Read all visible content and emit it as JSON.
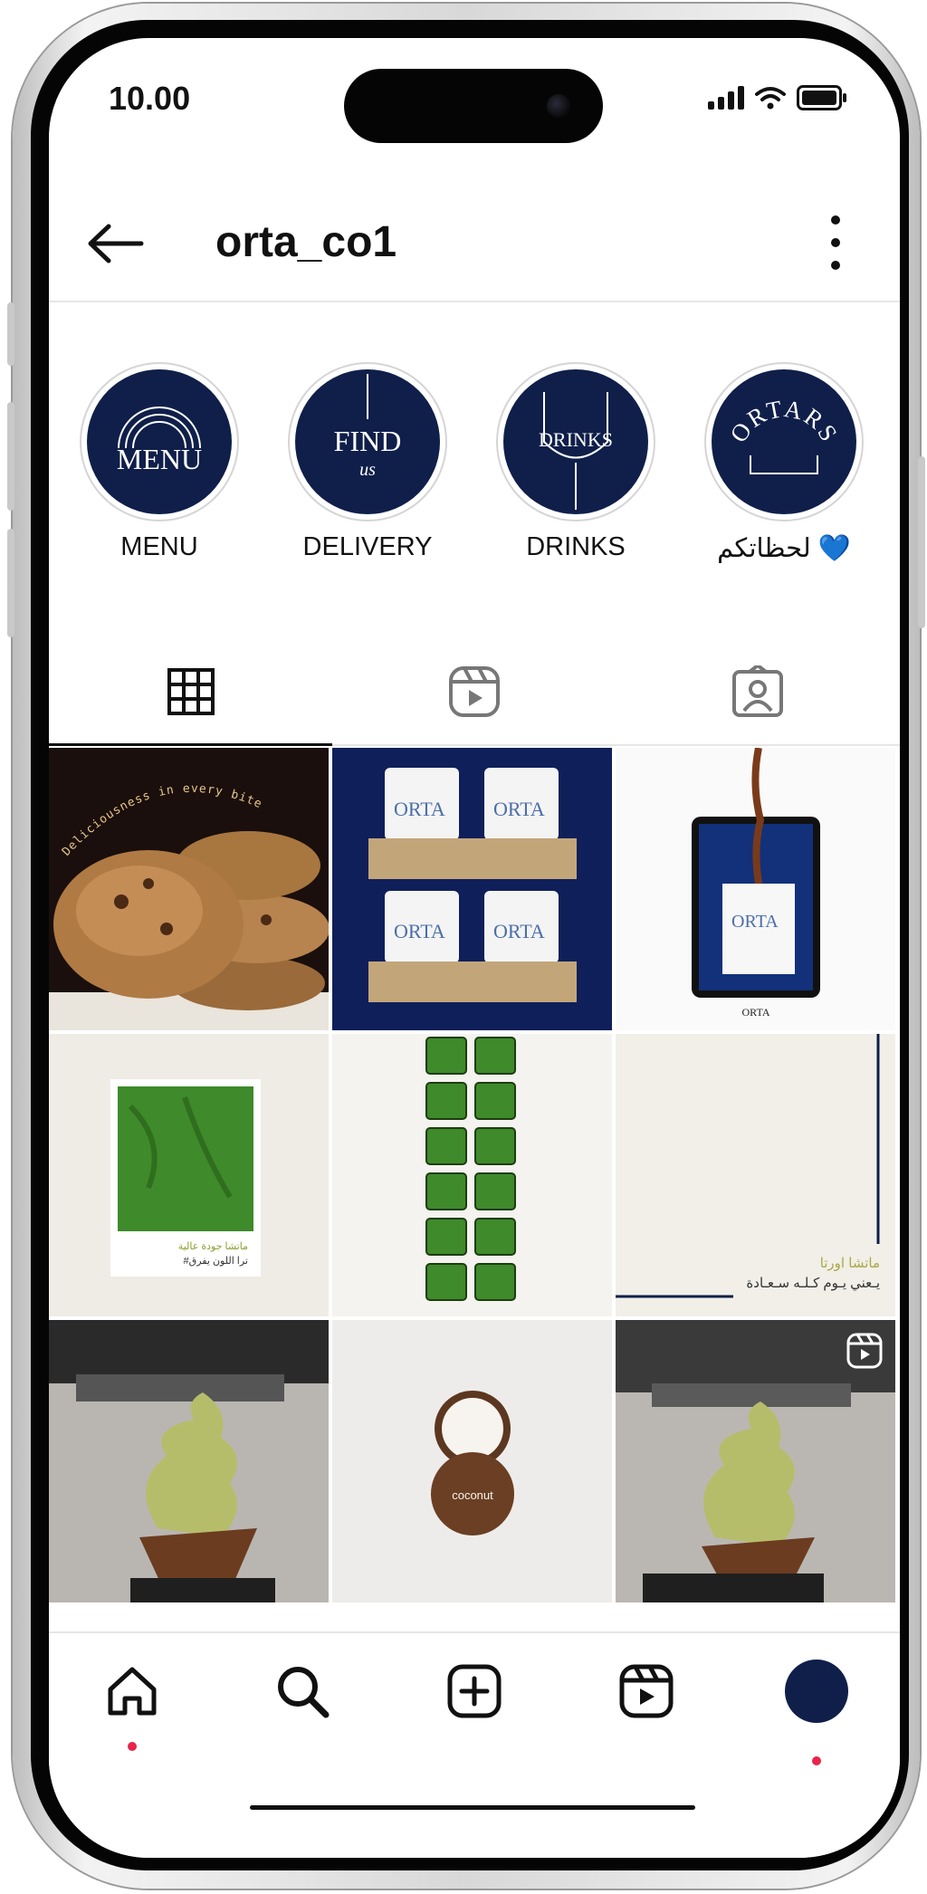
{
  "status_bar": {
    "time": "10.00"
  },
  "header": {
    "username": "orta_co1"
  },
  "highlights": [
    {
      "label": "MENU",
      "cover_text": "MENU"
    },
    {
      "label": "DELIVERY",
      "cover_text": "FIND",
      "cover_subtext": "us"
    },
    {
      "label": "DRINKS",
      "cover_text": "DRINKS"
    },
    {
      "label": "لحظاتكم 💙",
      "cover_text": "ORTARS"
    }
  ],
  "tabs": [
    {
      "name": "grid",
      "icon": "grid-icon",
      "active": true
    },
    {
      "name": "reels",
      "icon": "reels-icon",
      "active": false
    },
    {
      "name": "tagged",
      "icon": "tagged-icon",
      "active": false
    }
  ],
  "posts": {
    "cookies_caption": "Deliciousness in every bite",
    "cup_brand": "ORTA",
    "matcha_caption_1": "ماتشا جودة عالية",
    "matcha_caption_2": "#ترا اللون يفرق",
    "quote_title": "ماتشا اورتا",
    "quote_sub": "يـعني يـوم كـلـه سـعـادة",
    "coconut_label": "coconut"
  },
  "colors": {
    "brand_navy": "#0f1f4a",
    "notification_dot": "#e8244a"
  },
  "bottom_nav": [
    "home-icon",
    "search-icon",
    "create-icon",
    "reels-icon",
    "profile-avatar"
  ]
}
